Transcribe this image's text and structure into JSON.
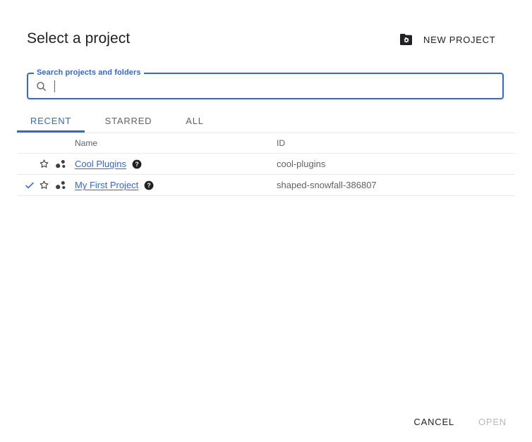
{
  "header": {
    "title": "Select a project",
    "new_project": {
      "label": "NEW PROJECT",
      "icon": "new-project-folder-icon"
    }
  },
  "search": {
    "label": "Search projects and folders",
    "value": "",
    "placeholder": "",
    "icon": "search-icon",
    "focused": true,
    "accent_color": "#3367d6"
  },
  "tabs": {
    "active_index": 0,
    "items": [
      {
        "label": "RECENT"
      },
      {
        "label": "STARRED"
      },
      {
        "label": "ALL"
      }
    ]
  },
  "table": {
    "columns": {
      "name": "Name",
      "id": "ID"
    },
    "rows": [
      {
        "selected": false,
        "starred": false,
        "star_icon": "star-outline-icon",
        "type_icon": "project-dots-icon",
        "name": "Cool Plugins",
        "help_icon": "help-circle-icon",
        "id": "cool-plugins"
      },
      {
        "selected": true,
        "check_icon": "check-icon",
        "starred": false,
        "star_icon": "star-outline-icon",
        "type_icon": "project-dots-icon",
        "name": "My First Project",
        "help_icon": "help-circle-icon",
        "id": "shaped-snowfall-386807"
      }
    ]
  },
  "footer": {
    "cancel_label": "CANCEL",
    "open_label": "OPEN",
    "open_disabled": true
  },
  "colors": {
    "accent": "#3367d6",
    "text_primary": "#202124",
    "text_secondary": "#5f6368",
    "divider": "#e8eaed",
    "disabled": "#b5b8bb"
  }
}
